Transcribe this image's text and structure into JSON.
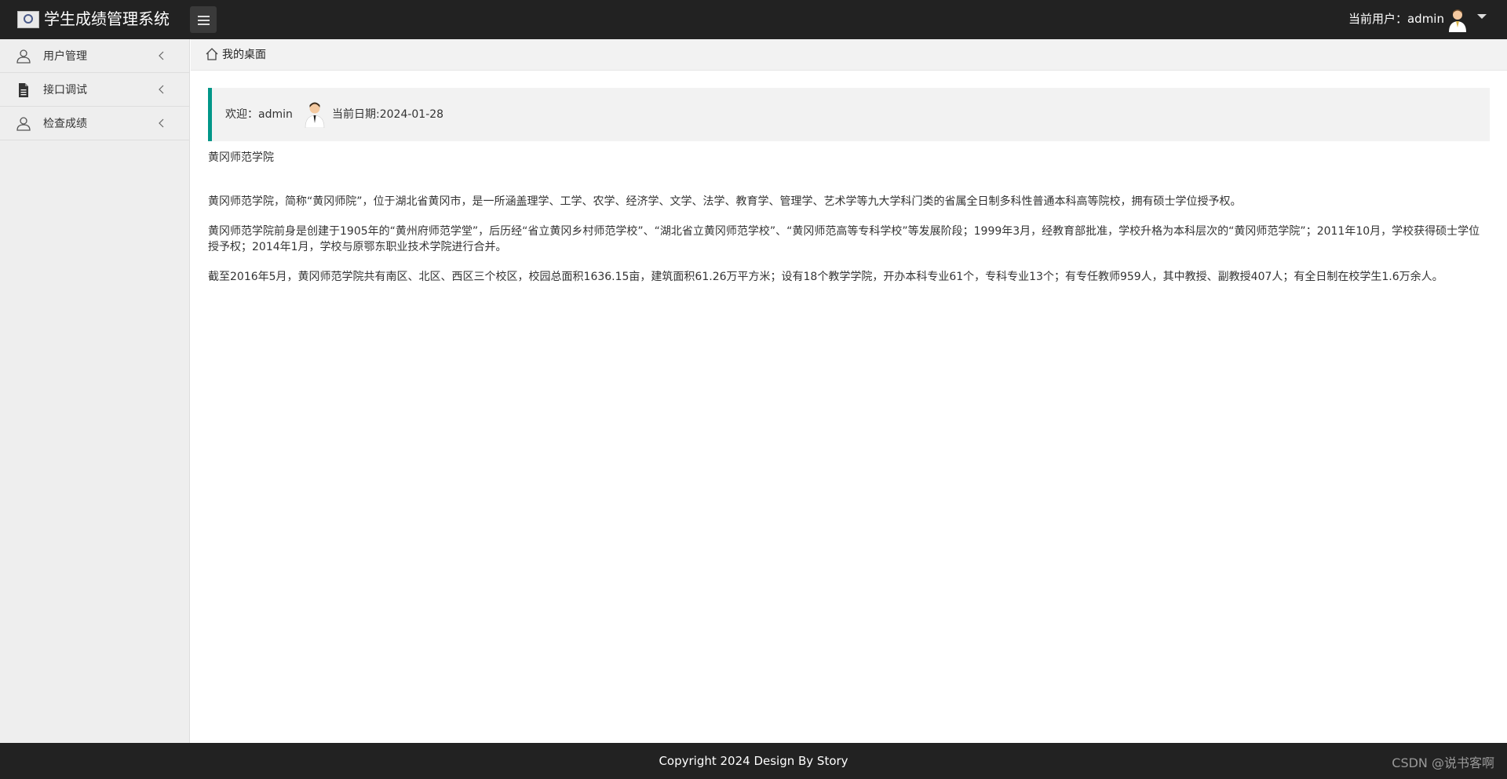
{
  "header": {
    "app_title": "学生成绩管理系统",
    "menu_toggle_icon": "hamburger-icon",
    "user_label": "当前用户：admin",
    "user_menu_icon": "caret-down-icon"
  },
  "sidebar": {
    "items": [
      {
        "label": "用户管理",
        "icon": "user-icon",
        "expand_icon": "chevron-left-icon"
      },
      {
        "label": "接口调试",
        "icon": "document-icon",
        "expand_icon": "chevron-left-icon"
      },
      {
        "label": "检查成绩",
        "icon": "user-icon",
        "expand_icon": "chevron-left-icon"
      }
    ]
  },
  "breadcrumb": {
    "icon": "home-icon",
    "label": "我的桌面"
  },
  "welcome": {
    "text": "欢迎：admin",
    "date_text": "当前日期:2024-01-28",
    "accent_color": "#009688"
  },
  "content": {
    "school_name": "黄冈师范学院",
    "paragraphs": [
      "黄冈师范学院，简称“黄冈师院”，位于湖北省黄冈市，是一所涵盖理学、工学、农学、经济学、文学、法学、教育学、管理学、艺术学等九大学科门类的省属全日制多科性普通本科高等院校，拥有硕士学位授予权。",
      "黄冈师范学院前身是创建于1905年的“黄州府师范学堂”，后历经“省立黄冈乡村师范学校”、“湖北省立黄冈师范学校”、“黄冈师范高等专科学校”等发展阶段；1999年3月，经教育部批准，学校升格为本科层次的“黄冈师范学院”；2011年10月，学校获得硕士学位授予权；2014年1月，学校与原鄂东职业技术学院进行合并。",
      "截至2016年5月，黄冈师范学院共有南区、北区、西区三个校区，校园总面积1636.15亩，建筑面积61.26万平方米；设有18个教学学院，开办本科专业61个，专科专业13个；有专任教师959人，其中教授、副教授407人；有全日制在校学生1.6万余人。"
    ]
  },
  "footer": {
    "copyright": "Copyright 2024 Design By Story",
    "watermark": "CSDN @说书客啊"
  },
  "colors": {
    "header_bg": "#222222",
    "sidebar_bg": "#eeeeee",
    "accent": "#009688"
  }
}
